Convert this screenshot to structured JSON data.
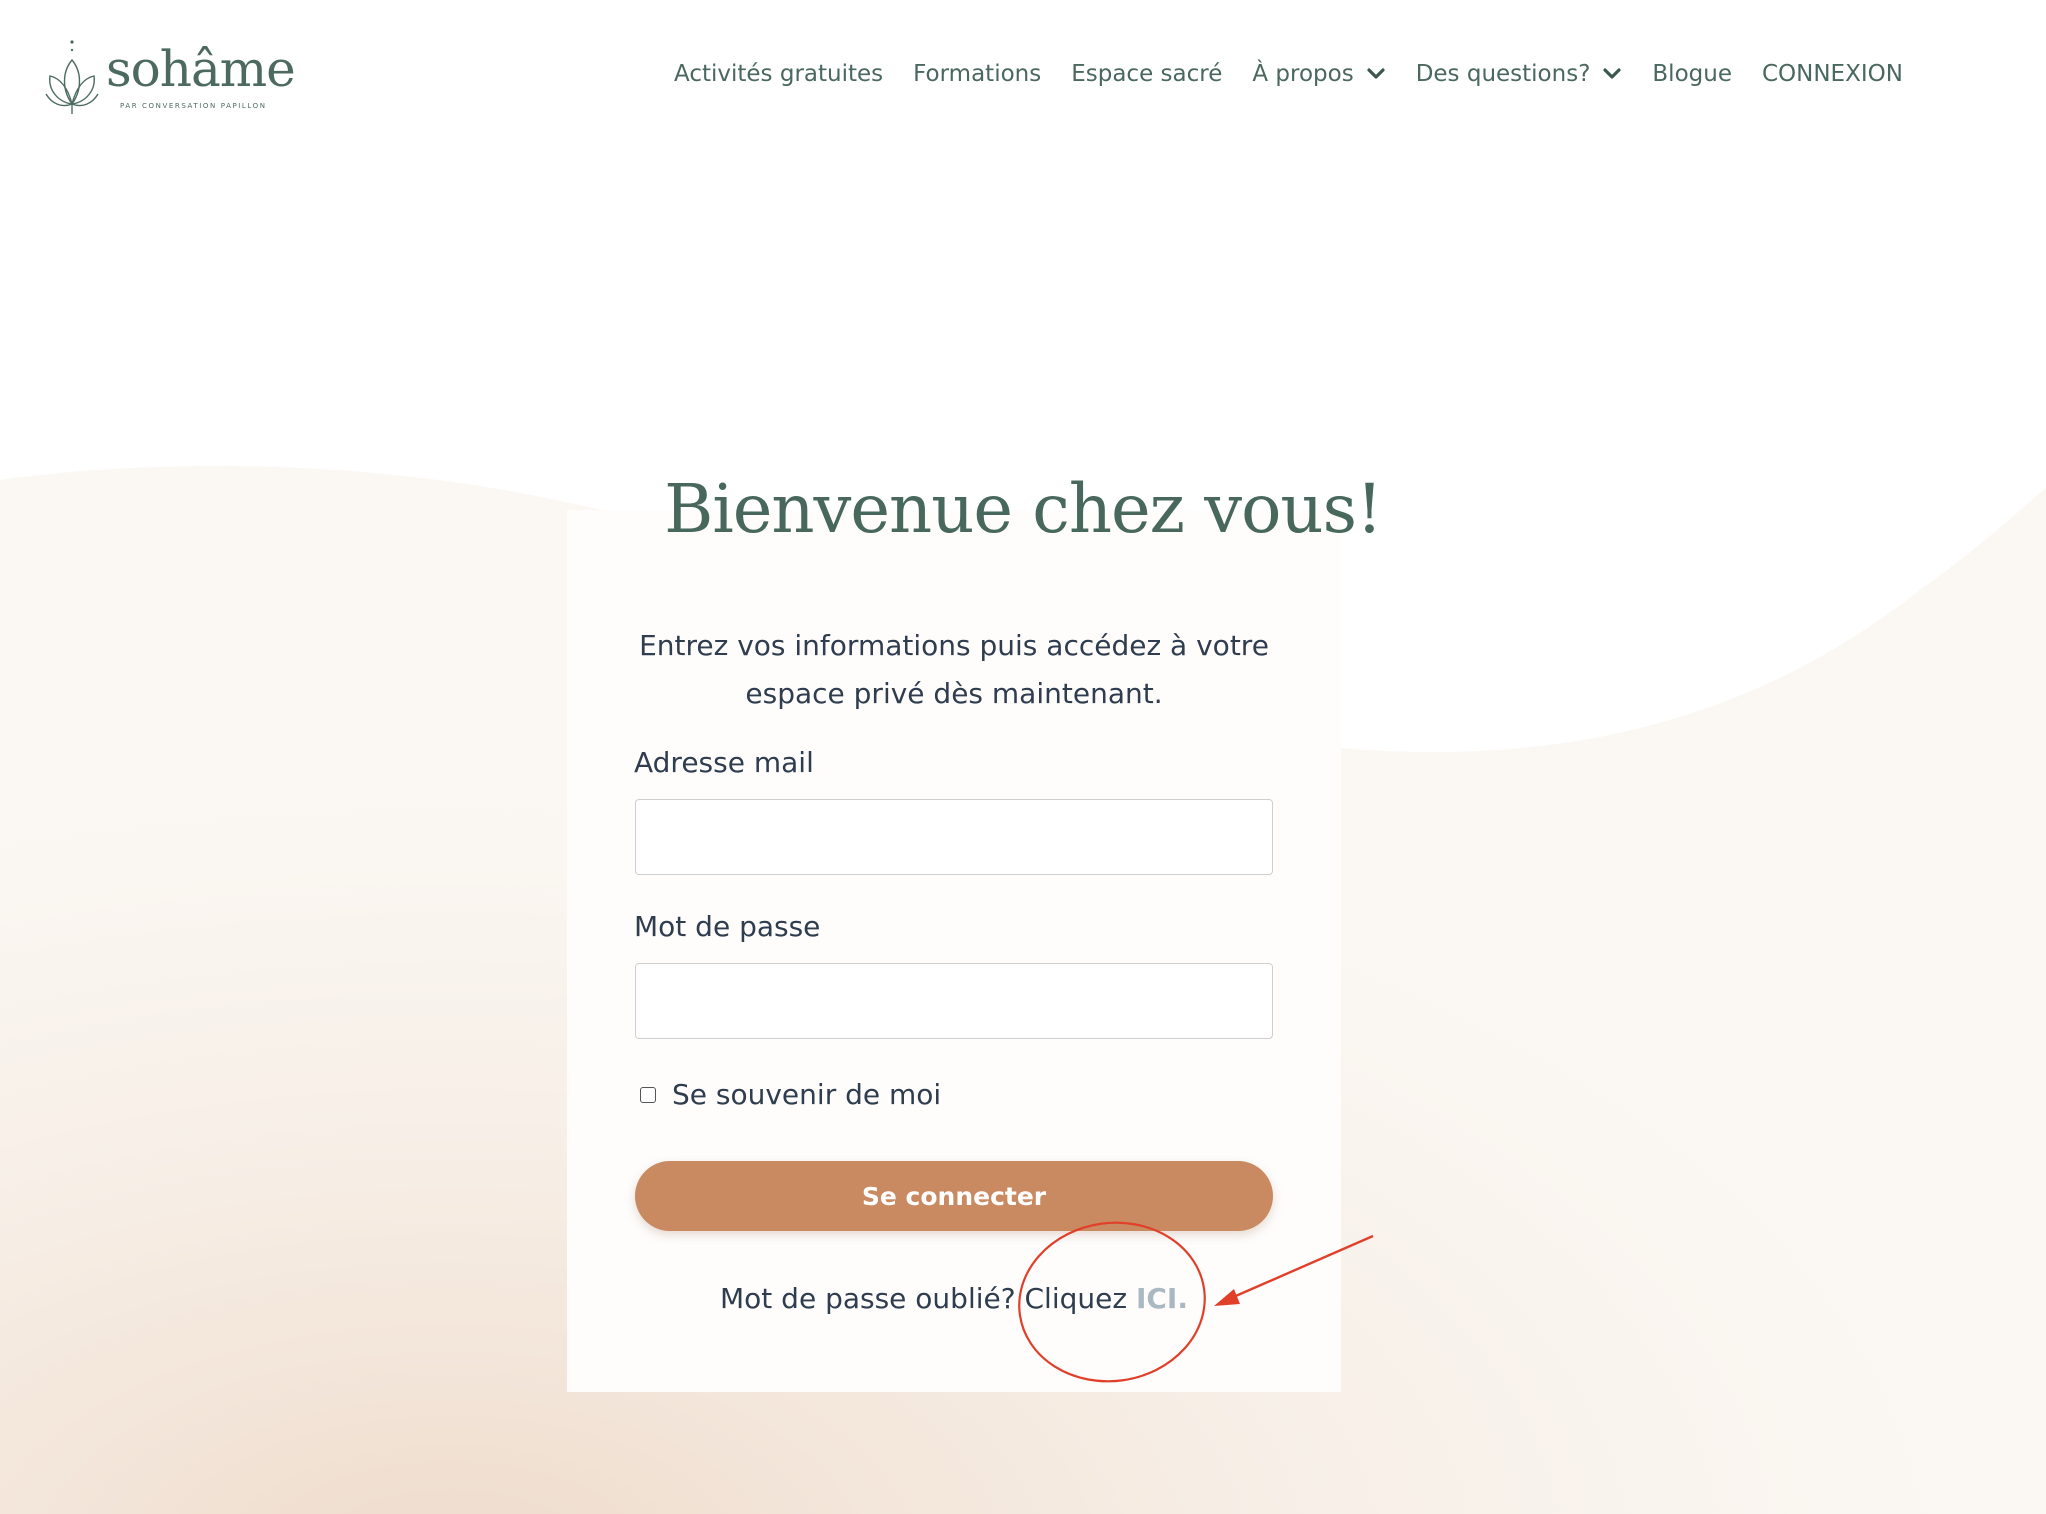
{
  "brand": {
    "name": "sohâme",
    "tagline": "PAR CONVERSATION PAPILLON",
    "primary_color": "#4a6760",
    "accent_color": "#c98a61"
  },
  "nav": {
    "items": [
      {
        "label": "Activités gratuites"
      },
      {
        "label": "Formations"
      },
      {
        "label": "Espace sacré"
      },
      {
        "label": "À propos",
        "icon": "chevron-down-icon"
      },
      {
        "label": "Des questions?",
        "icon": "chevron-down-icon"
      },
      {
        "label": "Blogue"
      },
      {
        "label": "CONNEXION"
      }
    ]
  },
  "login": {
    "title": "Bienvenue chez vous!",
    "intro": "Entrez vos informations puis accédez à votre espace privé dès maintenant.",
    "email_label": "Adresse mail",
    "email_value": "",
    "password_label": "Mot de passe",
    "password_value": "",
    "remember_label": "Se souvenir de moi",
    "remember_checked": false,
    "submit_label": "Se connecter",
    "forgot_text": "Mot de passe oublié? Cliquez ",
    "forgot_link": "ICI."
  },
  "annotation": {
    "color": "#e0402a",
    "shapes": [
      "circle",
      "arrow"
    ]
  }
}
